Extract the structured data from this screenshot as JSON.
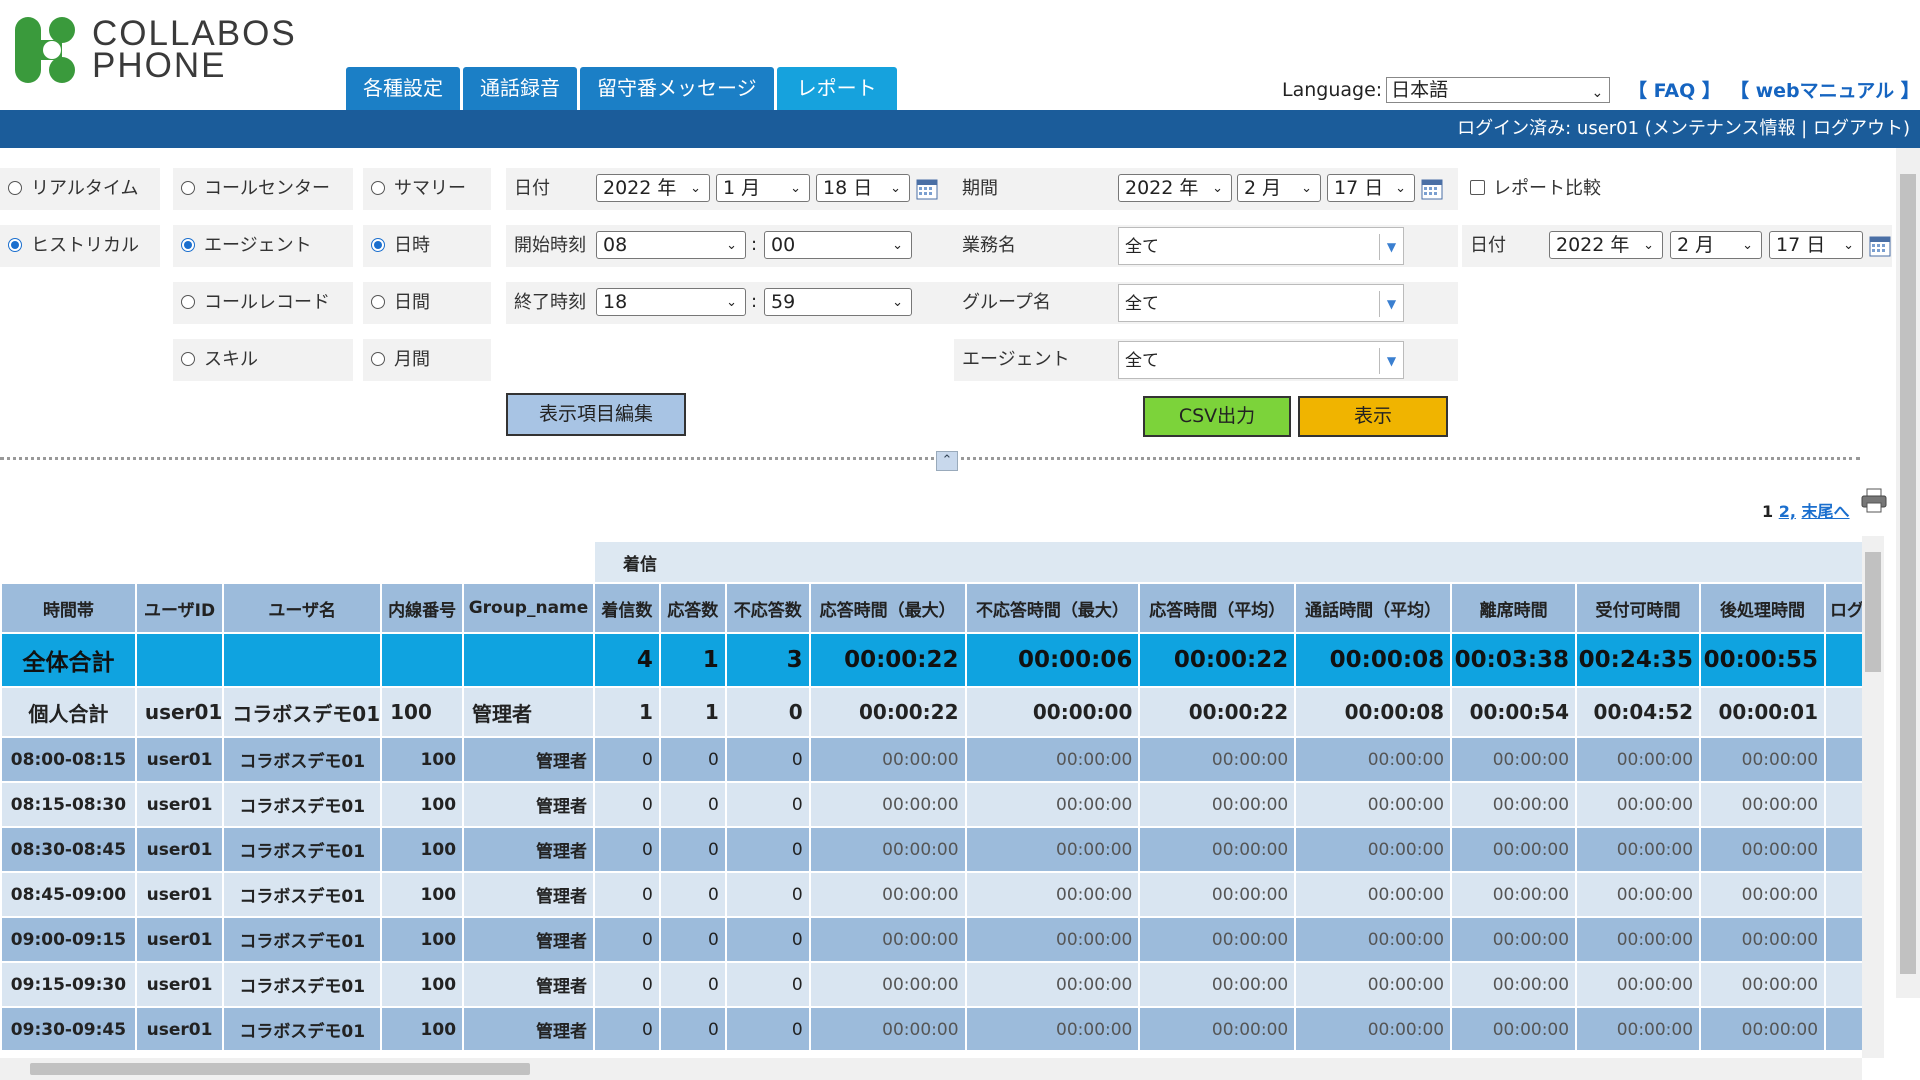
{
  "logo": {
    "line1": "COLLABOS",
    "line2": "PHONE"
  },
  "tabs": [
    {
      "label": "各種設定"
    },
    {
      "label": "通話録音"
    },
    {
      "label": "留守番メッセージ"
    },
    {
      "label": "レポート",
      "active": true
    }
  ],
  "language": {
    "label": "Language:",
    "value": "日本語"
  },
  "links": {
    "faq": "【 FAQ 】",
    "manual": "【 webマニュアル 】"
  },
  "login": {
    "text": "ログイン済み: user01 (メンテナンス情報 | ログアウト)"
  },
  "filters": {
    "mode": [
      "リアルタイム",
      "ヒストリカル"
    ],
    "type": [
      "コールセンター",
      "エージェント",
      "コールレコード",
      "スキル"
    ],
    "unit": [
      "サマリー",
      "日時",
      "日間",
      "月間"
    ],
    "date_label": "日付",
    "date": {
      "year": "2022 年",
      "month": "1 月",
      "day": "18 日"
    },
    "start_label": "開始時刻",
    "start": {
      "hour": "08",
      "min": "00"
    },
    "end_label": "終了時刻",
    "end": {
      "hour": "18",
      "min": "59"
    },
    "period_label": "期間",
    "period": {
      "year": "2022 年",
      "month": "2 月",
      "day": "17 日"
    },
    "compare_label": "レポート比較",
    "business_label": "業務名",
    "business_value": "全て",
    "group_label": "グループ名",
    "group_value": "全て",
    "agent_label": "エージェント",
    "agent_value": "全て",
    "date2_label": "日付",
    "date2": {
      "year": "2022 年",
      "month": "2 月",
      "day": "17 日"
    },
    "edit_button": "表示項目編集",
    "csv_button": "CSV出力",
    "show_button": "表示"
  },
  "pager": {
    "current": "1",
    "next": "2,",
    "last": "末尾へ"
  },
  "colors": {
    "accent": "#1b7fc6",
    "topbar": "#1b5c9a",
    "total_row": "#0fa3e0",
    "csv": "#7cd33a",
    "show": "#f0b400"
  },
  "table": {
    "group_header": "着信",
    "headers": [
      "時間帯",
      "ユーザID",
      "ユーザ名",
      "内線番号",
      "Group_name",
      "着信数",
      "応答数",
      "不応答数",
      "応答時間（最大）",
      "不応答時間（最大）",
      "応答時間（平均）",
      "通話時間（平均）",
      "離席時間",
      "受付可時間",
      "後処理時間",
      "ログ"
    ],
    "total": {
      "label": "全体合計",
      "calls": "4",
      "answered": "1",
      "unanswered": "3",
      "ans_max": "00:00:22",
      "unans_max": "00:00:06",
      "ans_avg": "00:00:22",
      "talk_avg": "00:00:08",
      "away": "00:03:38",
      "ready": "00:24:35",
      "after": "00:00:55"
    },
    "personal": {
      "label": "個人合計",
      "user_id": "user01",
      "user_name": "コラボスデモ01",
      "ext": "100",
      "group": "管理者",
      "calls": "1",
      "answered": "1",
      "unanswered": "0",
      "ans_max": "00:00:22",
      "unans_max": "00:00:00",
      "ans_avg": "00:00:22",
      "talk_avg": "00:00:08",
      "away": "00:00:54",
      "ready": "00:04:52",
      "after": "00:00:01"
    },
    "rows": [
      {
        "slot": "08:00-08:15",
        "user_id": "user01",
        "user_name": "コラボスデモ01",
        "ext": "100",
        "group": "管理者",
        "calls": "0",
        "answered": "0",
        "unanswered": "0",
        "ans_max": "00:00:00",
        "unans_max": "00:00:00",
        "ans_avg": "00:00:00",
        "talk_avg": "00:00:00",
        "away": "00:00:00",
        "ready": "00:00:00",
        "after": "00:00:00"
      },
      {
        "slot": "08:15-08:30",
        "user_id": "user01",
        "user_name": "コラボスデモ01",
        "ext": "100",
        "group": "管理者",
        "calls": "0",
        "answered": "0",
        "unanswered": "0",
        "ans_max": "00:00:00",
        "unans_max": "00:00:00",
        "ans_avg": "00:00:00",
        "talk_avg": "00:00:00",
        "away": "00:00:00",
        "ready": "00:00:00",
        "after": "00:00:00"
      },
      {
        "slot": "08:30-08:45",
        "user_id": "user01",
        "user_name": "コラボスデモ01",
        "ext": "100",
        "group": "管理者",
        "calls": "0",
        "answered": "0",
        "unanswered": "0",
        "ans_max": "00:00:00",
        "unans_max": "00:00:00",
        "ans_avg": "00:00:00",
        "talk_avg": "00:00:00",
        "away": "00:00:00",
        "ready": "00:00:00",
        "after": "00:00:00"
      },
      {
        "slot": "08:45-09:00",
        "user_id": "user01",
        "user_name": "コラボスデモ01",
        "ext": "100",
        "group": "管理者",
        "calls": "0",
        "answered": "0",
        "unanswered": "0",
        "ans_max": "00:00:00",
        "unans_max": "00:00:00",
        "ans_avg": "00:00:00",
        "talk_avg": "00:00:00",
        "away": "00:00:00",
        "ready": "00:00:00",
        "after": "00:00:00"
      },
      {
        "slot": "09:00-09:15",
        "user_id": "user01",
        "user_name": "コラボスデモ01",
        "ext": "100",
        "group": "管理者",
        "calls": "0",
        "answered": "0",
        "unanswered": "0",
        "ans_max": "00:00:00",
        "unans_max": "00:00:00",
        "ans_avg": "00:00:00",
        "talk_avg": "00:00:00",
        "away": "00:00:00",
        "ready": "00:00:00",
        "after": "00:00:00"
      },
      {
        "slot": "09:15-09:30",
        "user_id": "user01",
        "user_name": "コラボスデモ01",
        "ext": "100",
        "group": "管理者",
        "calls": "0",
        "answered": "0",
        "unanswered": "0",
        "ans_max": "00:00:00",
        "unans_max": "00:00:00",
        "ans_avg": "00:00:00",
        "talk_avg": "00:00:00",
        "away": "00:00:00",
        "ready": "00:00:00",
        "after": "00:00:00"
      },
      {
        "slot": "09:30-09:45",
        "user_id": "user01",
        "user_name": "コラボスデモ01",
        "ext": "100",
        "group": "管理者",
        "calls": "0",
        "answered": "0",
        "unanswered": "0",
        "ans_max": "00:00:00",
        "unans_max": "00:00:00",
        "ans_avg": "00:00:00",
        "talk_avg": "00:00:00",
        "away": "00:00:00",
        "ready": "00:00:00",
        "after": "00:00:00"
      }
    ]
  }
}
